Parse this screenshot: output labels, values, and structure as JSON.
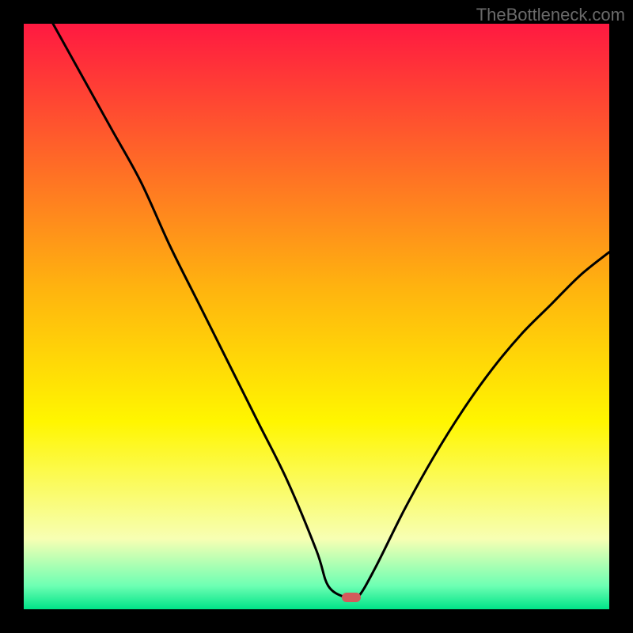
{
  "header": {
    "watermark": "TheBottleneck.com"
  },
  "chart_data": {
    "type": "line",
    "title": "",
    "xlabel": "",
    "ylabel": "",
    "xlim": [
      0,
      100
    ],
    "ylim": [
      0,
      100
    ],
    "grid": false,
    "legend": false,
    "background_gradient": [
      {
        "offset": 0,
        "color": "#ff1941"
      },
      {
        "offset": 45,
        "color": "#ffb30f"
      },
      {
        "offset": 68,
        "color": "#fff600"
      },
      {
        "offset": 88,
        "color": "#f7ffb3"
      },
      {
        "offset": 96,
        "color": "#6dffb3"
      },
      {
        "offset": 100,
        "color": "#00e388"
      }
    ],
    "series": [
      {
        "name": "bottleneck-curve",
        "color": "#000000",
        "x": [
          5,
          10,
          15,
          20,
          25,
          30,
          35,
          40,
          45,
          50,
          52,
          55,
          57,
          60,
          65,
          70,
          75,
          80,
          85,
          90,
          95,
          100
        ],
        "y": [
          100,
          91,
          82,
          73,
          62,
          52,
          42,
          32,
          22,
          10,
          4,
          2,
          2,
          7,
          17,
          26,
          34,
          41,
          47,
          52,
          57,
          61
        ]
      }
    ],
    "marker": {
      "name": "optimal-config",
      "x": 56,
      "y": 2,
      "color": "#d35b5b"
    }
  }
}
